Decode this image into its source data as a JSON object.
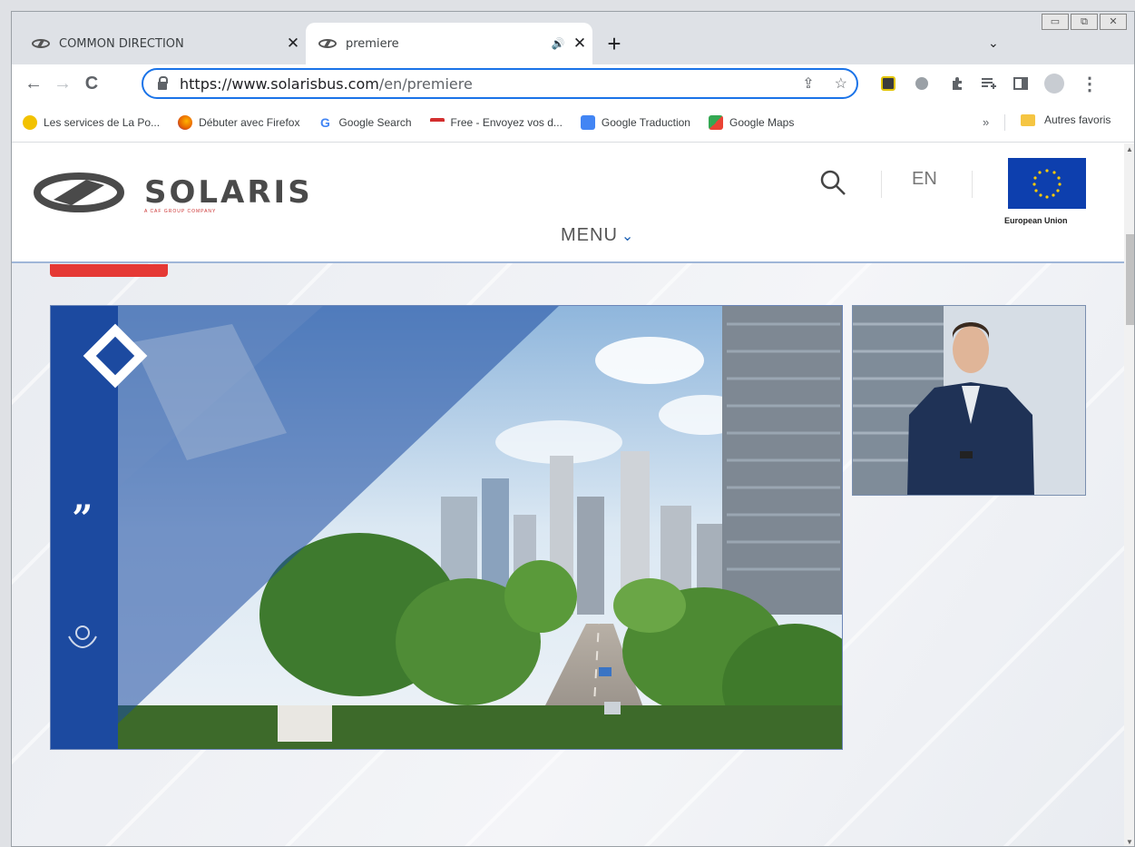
{
  "tabs": [
    {
      "title": "COMMON DIRECTION",
      "close": "✕",
      "favicon": "solaris-favicon"
    },
    {
      "title": "premiere",
      "close": "✕",
      "audio": "🔊",
      "favicon": "solaris-favicon"
    }
  ],
  "new_tab": "+",
  "tab_search": "⌄",
  "window_controls": [
    "▭",
    "⧉",
    "✕"
  ],
  "toolbar": {
    "back": "←",
    "forward": "→",
    "reload": "C",
    "url_host": "https://www.solarisbus.com",
    "url_path": "/en/premiere",
    "share": "⇪",
    "bookmark_star": "☆",
    "menu": "⋮"
  },
  "bookmarks": [
    {
      "label": "Les services de La Po...",
      "color": "#f2c200"
    },
    {
      "label": "Débuter avec Firefox",
      "color": "#e66000"
    },
    {
      "label": "Google Search",
      "color": "#4285f4"
    },
    {
      "label": "Free - Envoyez vos d...",
      "color": "#d32f2f"
    },
    {
      "label": "Google Traduction",
      "color": "#4285f4"
    },
    {
      "label": "Google Maps",
      "color": "#34a853"
    }
  ],
  "bookmarks_more": "»",
  "bookmarks_folder": "Autres favoris",
  "site": {
    "brand": "SOLARIS",
    "brand_sub": "A CAF GROUP COMPANY",
    "lang": "EN",
    "eu_label": "European Union",
    "menu_label": "MENU",
    "menu_chevron": "⌄",
    "quote_glyph": "„"
  },
  "colors": {
    "accent_blue": "#1c4aa0",
    "live_red": "#e53935",
    "eu_blue": "#0d3fae",
    "omnibox_focus": "#1a73e8"
  }
}
